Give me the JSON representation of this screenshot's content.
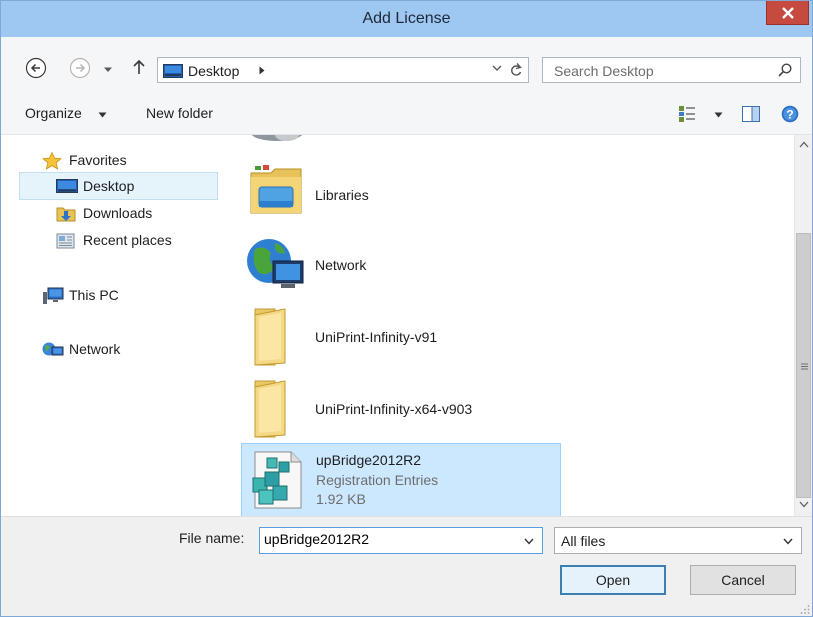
{
  "window": {
    "title": "Add License"
  },
  "address": {
    "location": "Desktop",
    "search_placeholder": "Search Desktop"
  },
  "toolbar": {
    "organize": "Organize",
    "new_folder": "New folder"
  },
  "nav": {
    "favorites": "Favorites",
    "desktop": "Desktop",
    "downloads": "Downloads",
    "recent": "Recent places",
    "this_pc": "This PC",
    "network": "Network"
  },
  "files": [
    {
      "name": "Libraries",
      "icon": "libraries-icon"
    },
    {
      "name": "Network",
      "icon": "network-globe-icon"
    },
    {
      "name": "UniPrint-Infinity-v91",
      "icon": "folder-icon"
    },
    {
      "name": "UniPrint-Infinity-x64-v903",
      "icon": "folder-icon"
    }
  ],
  "selected_file": {
    "name": "upBridge2012R2",
    "type": "Registration Entries",
    "size": "1.92 KB"
  },
  "bottom": {
    "file_name_label": "File name:",
    "file_name_value": "upBridge2012R2",
    "file_type": "All files",
    "open": "Open",
    "cancel": "Cancel"
  },
  "colors": {
    "selection": "#cce8ff",
    "titlebar": "#9ec7f1",
    "close": "#c64a40"
  }
}
